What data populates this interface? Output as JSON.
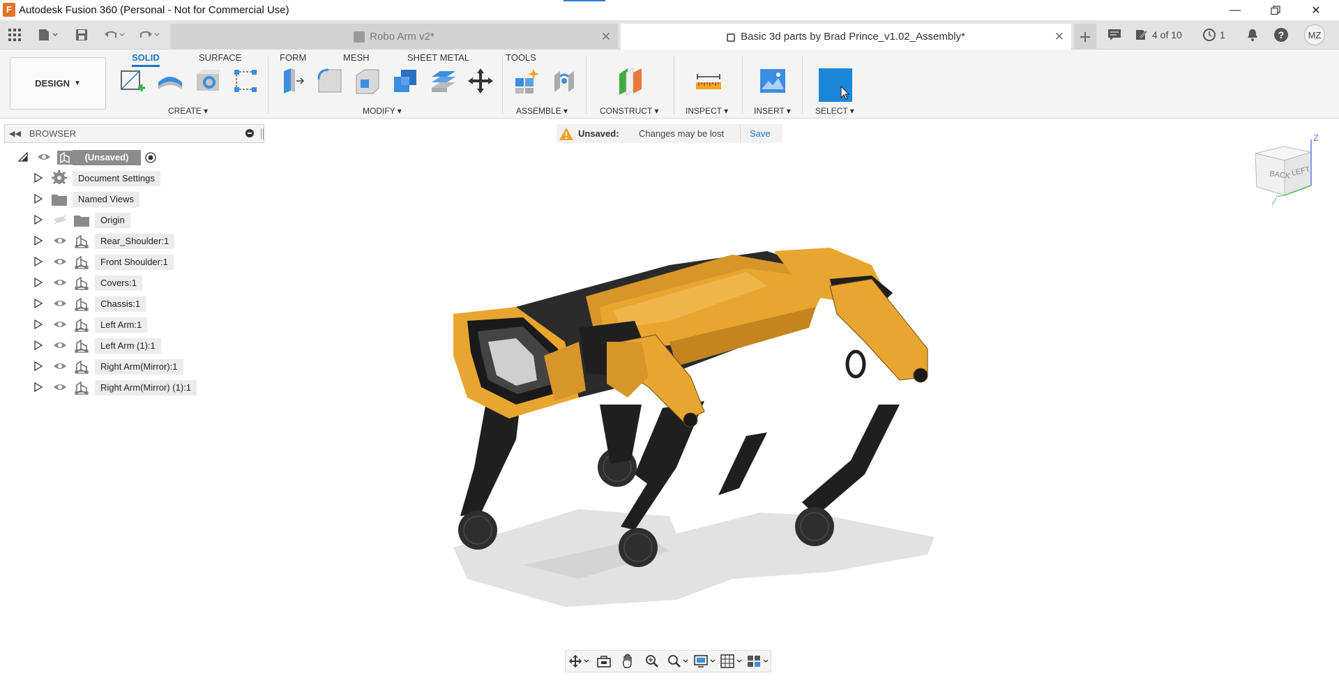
{
  "window": {
    "title": "Autodesk Fusion 360 (Personal - Not for Commercial Use)",
    "logo_letter": "F"
  },
  "tabs": [
    {
      "label": "Robo Arm v2*"
    },
    {
      "label": "Basic 3d parts by Brad Prince_v1.02_Assembly*"
    }
  ],
  "tabbar_right": {
    "job_status": "4 of 10",
    "history_count": "1",
    "user_initials": "MZ"
  },
  "workspace": {
    "label": "DESIGN"
  },
  "workspace_tabs": [
    "SOLID",
    "SURFACE",
    "FORM",
    "MESH",
    "SHEET METAL",
    "TOOLS"
  ],
  "tool_groups": [
    "CREATE",
    "MODIFY",
    "ASSEMBLE",
    "CONSTRUCT",
    "INSPECT",
    "INSERT",
    "SELECT"
  ],
  "browser": {
    "title": "BROWSER",
    "root": "(Unsaved)",
    "items": [
      {
        "label": "Document Settings"
      },
      {
        "label": "Named Views"
      },
      {
        "label": "Origin"
      },
      {
        "label": "Rear_Shoulder:1"
      },
      {
        "label": "Front Shoulder:1"
      },
      {
        "label": "Covers:1"
      },
      {
        "label": "Chassis:1"
      },
      {
        "label": "Left Arm:1"
      },
      {
        "label": "Left Arm (1):1"
      },
      {
        "label": "Right Arm(Mirror):1"
      },
      {
        "label": "Right Arm(Mirror) (1):1"
      }
    ]
  },
  "banner": {
    "title": "Unsaved:",
    "message": "Changes may be lost",
    "action": "Save"
  },
  "viewcube": {
    "face_back": "BACK",
    "face_left": "LEFT",
    "axis_z": "Z"
  },
  "colors": {
    "accent": "#1c72c9",
    "model_body": "#e8a630",
    "model_dark": "#1e1e1e"
  }
}
